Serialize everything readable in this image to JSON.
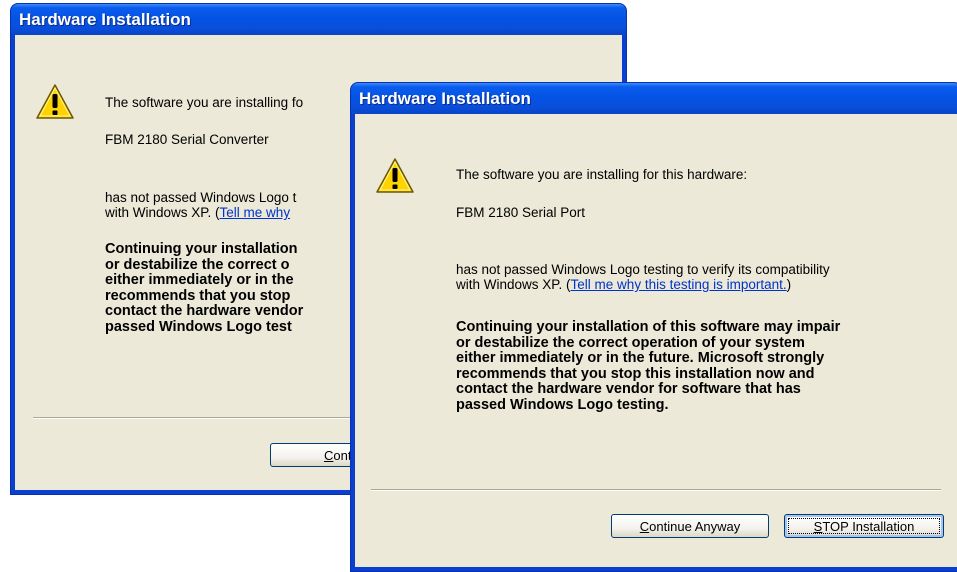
{
  "back_dialog": {
    "title": "Hardware Installation",
    "intro": "The software you are installing fo",
    "device": "FBM 2180 Serial Converter",
    "para_line1": "has not passed Windows Logo t",
    "para_line2_prefix": "with Windows XP. ",
    "link_text": "Tell me why",
    "link_open": "(",
    "warning_lines": [
      "Continuing your installation",
      "or destabilize the correct o",
      "either immediately or in the",
      "recommends that you stop",
      "contact the hardware vendor",
      "passed Windows Logo test"
    ],
    "continue_button": {
      "accel": "C",
      "rest": "ontinue"
    }
  },
  "front_dialog": {
    "title": "Hardware Installation",
    "intro": "The software you are installing for this hardware:",
    "device": "FBM 2180 Serial Port",
    "para_line1": "has not passed Windows Logo testing to verify its compatibility",
    "para_line2_prefix": "with Windows XP. ",
    "link_open": "(",
    "link_text": "Tell me why this testing is important.",
    "link_close": ")",
    "warning_lines": [
      "Continuing your installation of this software may impair",
      "or destabilize the correct operation of your system",
      "either immediately or in the future. Microsoft strongly",
      "recommends that you stop this installation now and",
      "contact the hardware vendor for software that has",
      "passed Windows Logo testing."
    ],
    "continue_button": {
      "accel": "C",
      "rest": "ontinue Anyway"
    },
    "stop_button": {
      "accel": "S",
      "rest": "TOP Installation"
    }
  },
  "icons": {
    "warning": "warning-icon"
  },
  "colors": {
    "titlebar": "#0353e6",
    "client": "#ece9d8",
    "link": "#0033cc",
    "icon_fill": "#ffd200"
  }
}
